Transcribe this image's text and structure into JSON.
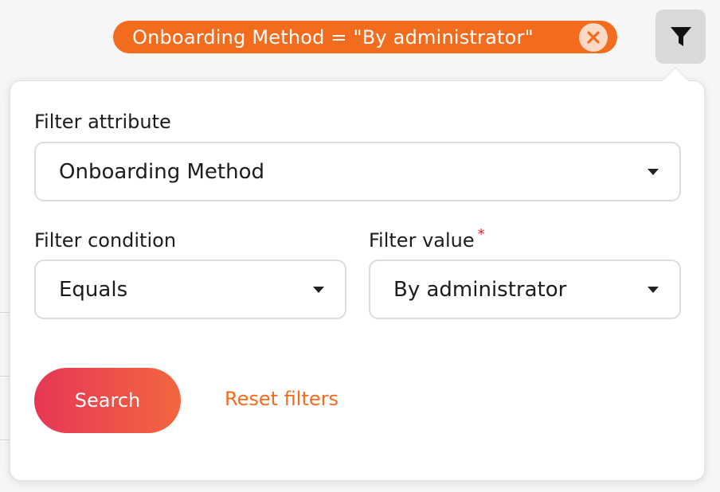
{
  "active_filter": {
    "label": "Onboarding Method = \"By administrator\"",
    "remove_icon": "close-circle-icon"
  },
  "filter_button": {
    "icon": "funnel-icon"
  },
  "panel": {
    "attribute": {
      "label": "Filter attribute",
      "value": "Onboarding Method"
    },
    "condition": {
      "label": "Filter condition",
      "value": "Equals"
    },
    "value": {
      "label": "Filter value",
      "required_mark": "*",
      "value": "By administrator"
    },
    "search_label": "Search",
    "reset_label": "Reset filters"
  },
  "colors": {
    "accent": "#f36b1c",
    "button_gradient_start": "#e63756",
    "button_gradient_end": "#f3663f",
    "required": "#e8232a"
  }
}
